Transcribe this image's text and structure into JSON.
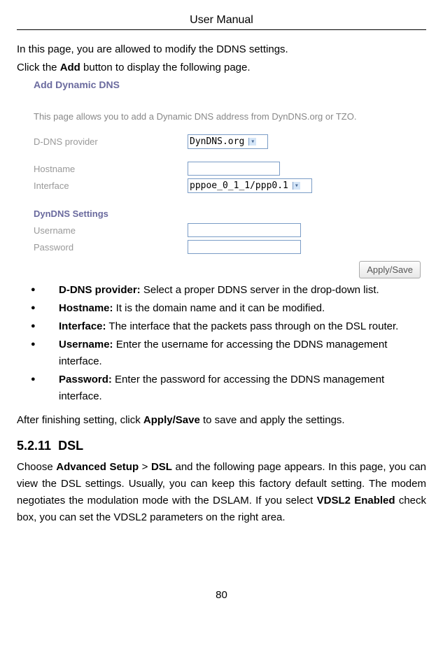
{
  "header": {
    "title": "User Manual"
  },
  "intro": {
    "line1": "In this page, you are allowed to modify the DDNS settings.",
    "line2_pre": "Click the ",
    "line2_bold": "Add",
    "line2_post": " button to display the following page."
  },
  "form": {
    "title": "Add Dynamic DNS",
    "description": "This page allows you to add a Dynamic DNS address from DynDNS.org or TZO.",
    "provider_label": "D-DNS provider",
    "provider_value": "DynDNS.org",
    "hostname_label": "Hostname",
    "interface_label": "Interface",
    "interface_value": "pppoe_0_1_1/ppp0.1",
    "settings_title": "DynDNS Settings",
    "username_label": "Username",
    "password_label": "Password",
    "apply_button": "Apply/Save"
  },
  "bullets": {
    "b1_label": "D-DNS provider:",
    "b1_text": " Select a proper DDNS server in the drop-down list.",
    "b2_label": "Hostname:",
    "b2_text": " It is the domain name and it can be modified.",
    "b3_label": "Interface:",
    "b3_text": " The interface that the packets pass through on the DSL router.",
    "b4_label": "Username:",
    "b4_text": " Enter the username for accessing the DDNS management interface.",
    "b5_label": "Password:",
    "b5_text": " Enter the password for accessing the DDNS management interface."
  },
  "after_pre": "After finishing setting, click ",
  "after_bold": "Apply/Save",
  "after_post": " to save and apply the settings.",
  "section": {
    "number": "5.2.11",
    "title": "DSL",
    "body_pre": "Choose ",
    "body_b1": "Advanced Setup",
    "body_mid1": " > ",
    "body_b2": "DSL",
    "body_mid2": " and the following page appears. In this page, you can view the DSL settings. Usually, you can keep this factory default setting. The modem negotiates the modulation mode with the DSLAM. If you select ",
    "body_b3": "VDSL2 Enabled",
    "body_post": " check box, you can set the VDSL2 parameters on the right area."
  },
  "page_number": "80"
}
